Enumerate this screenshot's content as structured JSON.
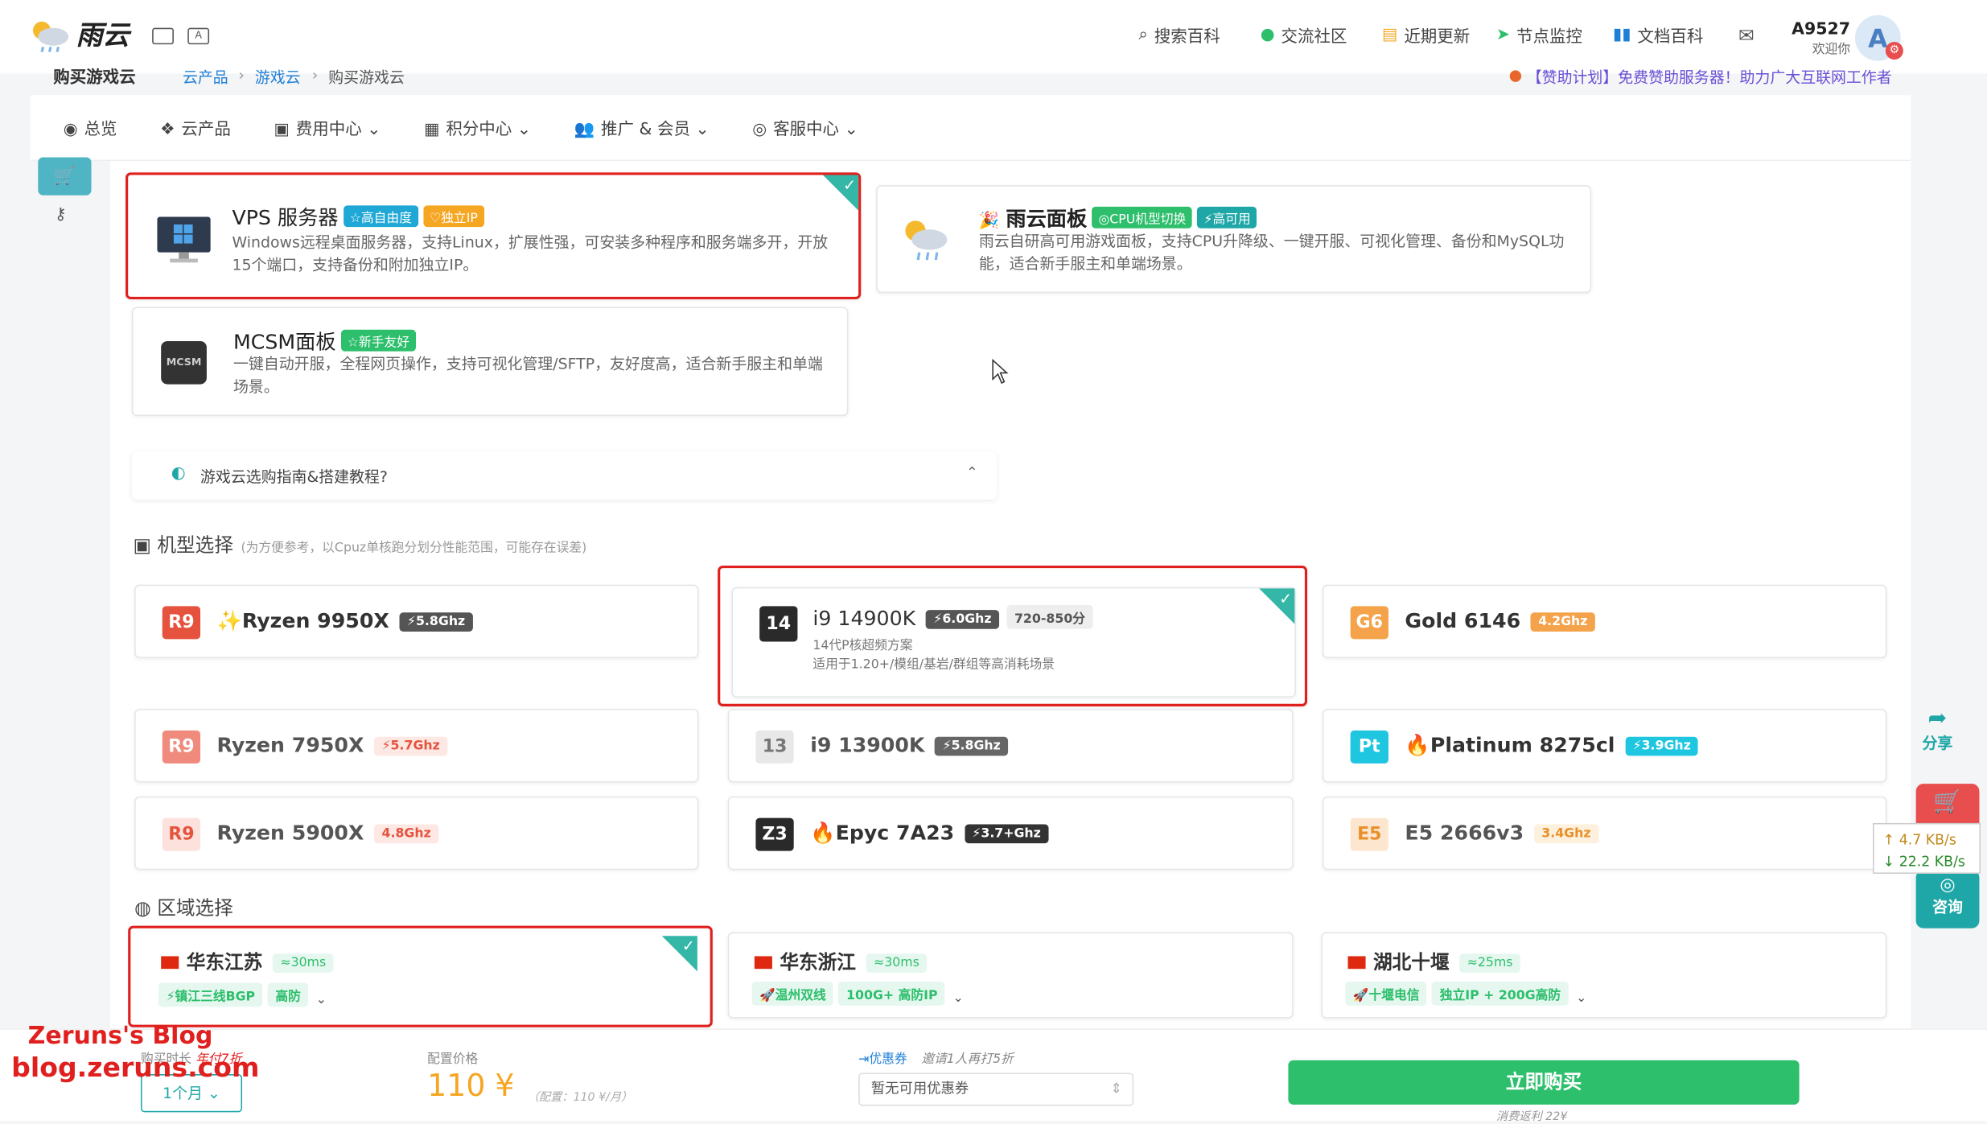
{
  "header": {
    "logo": "雨云",
    "nav": [
      {
        "icon": "search-icon",
        "label": "搜索百科"
      },
      {
        "icon": "wechat-icon",
        "label": "交流社区"
      },
      {
        "icon": "news-icon",
        "label": "近期更新"
      },
      {
        "icon": "send-icon",
        "label": "节点监控"
      },
      {
        "icon": "book-icon",
        "label": "文档百科"
      }
    ],
    "user": {
      "name": "A9527",
      "greet": "欢迎你",
      "avatar": "A"
    }
  },
  "breadcrumb": {
    "title": "购买游戏云",
    "items": [
      "云产品",
      "游戏云",
      "购买游戏云"
    ],
    "notice": "【赞助计划】免费赞助服务器！助力广大互联网工作者"
  },
  "menu": [
    {
      "label": "总览",
      "icon": "dashboard-icon"
    },
    {
      "label": "云产品",
      "icon": "cubes-icon"
    },
    {
      "label": "费用中心",
      "icon": "money-icon",
      "dd": "⌄"
    },
    {
      "label": "积分中心",
      "icon": "gift-icon",
      "dd": "⌄"
    },
    {
      "label": "推广 & 会员",
      "icon": "users-icon",
      "dd": "⌄"
    },
    {
      "label": "客服中心",
      "icon": "headset-icon",
      "dd": "⌄"
    }
  ],
  "products": [
    {
      "title": "VPS 服务器",
      "tags": [
        {
          "t": "☆高自由度",
          "c": "#1fa7d6"
        },
        {
          "t": "♡独立IP",
          "c": "#f5a623"
        }
      ],
      "desc": "Windows远程桌面服务器，支持Linux，扩展性强，可安装多种程序和服务端多开，开放15个端口，支持备份和附加独立IP。"
    },
    {
      "title": "雨云面板",
      "tags": [
        {
          "t": "◎CPU机型切换",
          "c": "#2dbf6c"
        },
        {
          "t": "⚡高可用",
          "c": "#1fa7a7"
        }
      ],
      "desc": "雨云自研高可用游戏面板，支持CPU升降级、一键开服、可视化管理、备份和MySQL功能，适合新手服主和单端场景。"
    },
    {
      "title": "MCSM面板",
      "icon_text": "MCSM",
      "tags": [
        {
          "t": "☆新手友好",
          "c": "#2dbf6c"
        }
      ],
      "desc": "一键自动开服，全程网页操作，支持可视化管理/SFTP，友好度高，适合新手服主和单端场景。"
    }
  ],
  "guide": "游戏云选购指南&搭建教程?",
  "cpu_section": {
    "title": "机型选择",
    "note": "(为方便参考，以Cpuz单核跑分划分性能范围，可能存在误差)"
  },
  "cpus": [
    {
      "badge": "R9",
      "name": "✨Ryzen 9950X",
      "ghz": "⚡5.8Ghz",
      "bc": "#e5533f",
      "gc": "#555",
      "gt": "#fff"
    },
    {
      "badge": "14",
      "name": "i9 14900K",
      "ghz": "⚡6.0Ghz",
      "extra": "720-850分",
      "sub1": "14代P核超频方案",
      "sub2": "适用于1.20+/模组/基岩/群组等高消耗场景",
      "bc": "#2a2a2a",
      "gc": "#555",
      "gt": "#fff"
    },
    {
      "badge": "G6",
      "name": "Gold 6146",
      "ghz": "4.2Ghz",
      "bc": "#f5a34a",
      "gc": "#f5a34a",
      "gt": "#fff"
    },
    {
      "badge": "R9",
      "name": "Ryzen 7950X",
      "ghz": "⚡5.7Ghz",
      "bc": "#ef8a7d",
      "gc": "#fde8e4",
      "gt": "#e5533f"
    },
    {
      "badge": "13",
      "name": "i9 13900K",
      "ghz": "⚡5.8Ghz",
      "bc": "#e8e8e8",
      "gc": "#666",
      "gt": "#fff",
      "btc": "#777"
    },
    {
      "badge": "Pt",
      "name": "🔥Platinum 8275cl",
      "ghz": "⚡3.9Ghz",
      "bc": "#1ec6e0",
      "gc": "#1ec6e0",
      "gt": "#fff"
    },
    {
      "badge": "R9",
      "name": "Ryzen 5900X",
      "ghz": "4.8Ghz",
      "bc": "#fde1dc",
      "gc": "#fde8e4",
      "gt": "#e5533f",
      "btc": "#e5533f"
    },
    {
      "badge": "Z3",
      "name": "🔥Epyc 7A23",
      "ghz": "⚡3.7+Ghz",
      "bc": "#2a2a2a",
      "gc": "#333",
      "gt": "#fff"
    },
    {
      "badge": "E5",
      "name": "E5 2666v3",
      "ghz": "3.4Ghz",
      "bc": "#fde6cf",
      "gc": "#fdf0dc",
      "gt": "#e8902a",
      "btc": "#e8902a"
    }
  ],
  "region_section": {
    "title": "区域选择"
  },
  "regions": [
    {
      "name": "华东江苏",
      "ping": "≈30ms",
      "line": "⚡镇江三线BGP",
      "extra": "高防"
    },
    {
      "name": "华东浙江",
      "ping": "≈30ms",
      "line": "🚀温州双线",
      "extra": "100G+ 高防IP"
    },
    {
      "name": "湖北十堰",
      "ping": "≈25ms",
      "line": "🚀十堰电信",
      "extra": "独立IP + 200G高防"
    }
  ],
  "footer": {
    "duration_label": "购买时长",
    "duration_note": "年付7折",
    "duration": "1个月",
    "price_label": "配置价格",
    "price": "110 ¥",
    "price_note": "（配置：110 ¥/月）",
    "coupon_label": "优惠券",
    "coupon_note": "邀请1人再打5折",
    "coupon_value": "暂无可用优惠券",
    "buy": "立即购买",
    "cashback": "消费返利 22¥"
  },
  "side": {
    "share": "分享",
    "consult": "咨询",
    "up": "↑ 4.7 KB/s",
    "down": "↓ 22.2 KB/s"
  },
  "watermark": {
    "line1": "Zeruns's Blog",
    "line2": "blog.zeruns.com"
  }
}
